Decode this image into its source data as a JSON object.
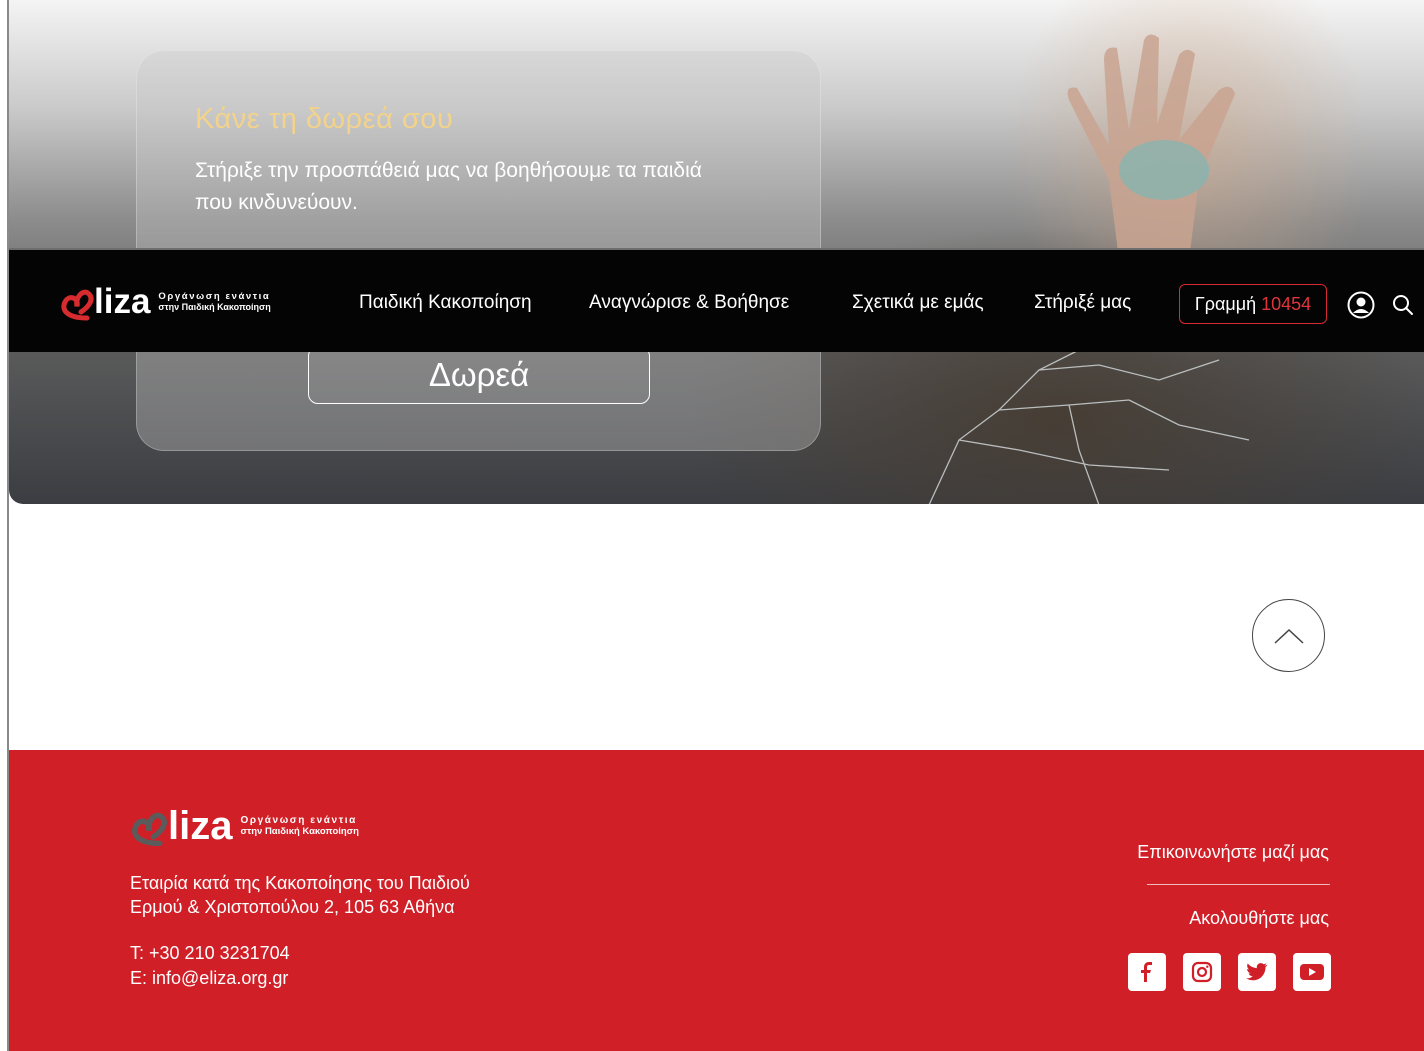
{
  "hero": {
    "title": "Κάνε τη δωρεά σου",
    "text": "Στήριξε την προσπάθειά μας να βοηθήσουμε τα παιδιά που κινδυνεύουν.",
    "button_label": "Δωρεά"
  },
  "brand": {
    "word": "liza",
    "tagline_line1": "Οργάνωση ενάντια",
    "tagline_line2": "στην Παιδική Κακοποίηση"
  },
  "nav": {
    "items": [
      {
        "label": "Παιδική Κακοποίηση"
      },
      {
        "label": "Αναγνώρισε & Βοήθησε"
      },
      {
        "label": "Σχετικά με εμάς"
      },
      {
        "label": "Στήριξέ μας"
      }
    ],
    "hotline_label": "Γραμμή",
    "hotline_number": "10454",
    "user_icon": "user-circle-icon",
    "search_icon": "search-icon"
  },
  "scroll_top_icon": "chevron-up-icon",
  "footer": {
    "org_name": "Εταιρία κατά της Κακοποίησης του Παιδιού",
    "address": "Ερμού & Χριστοπούλου 2, 105 63 Αθήνα",
    "phone": "Τ: +30 210 3231704",
    "email": "Ε: info@eliza.org.gr",
    "contact_link": "Επικοινωνήστε μαζί μας",
    "follow_label": "Ακολουθήστε μας",
    "social": [
      "facebook-icon",
      "instagram-icon",
      "twitter-icon",
      "youtube-icon"
    ]
  },
  "colors": {
    "brand_red": "#d01f27",
    "nav_bg": "#040404",
    "hero_title": "#f3d28a"
  }
}
